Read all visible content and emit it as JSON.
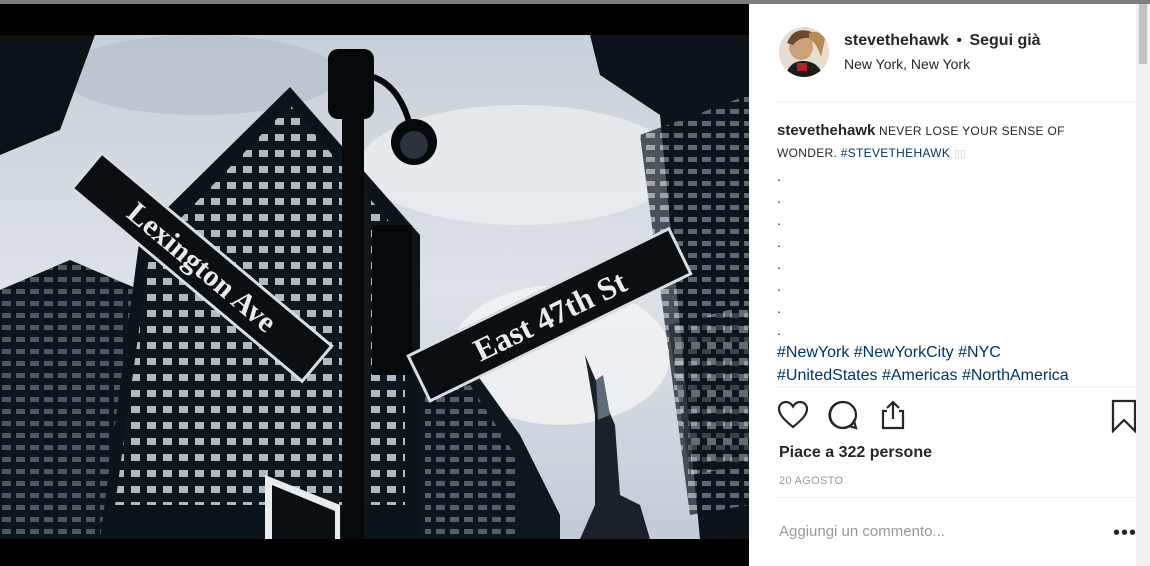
{
  "post": {
    "username": "stevethehawk",
    "separator": "•",
    "follow_status": "Segui già",
    "location": "New York, New York",
    "caption_user": "stevethehawk",
    "caption_text": "NEVER LOSE YOUR SENSE OF WONDER.",
    "caption_tag": "#STEVETHEHAWK",
    "dots": [
      ".",
      ".",
      ".",
      ".",
      ".",
      ".",
      ".",
      "."
    ],
    "hashtags_line1": "#NewYork #NewYorkCity #NYC",
    "hashtags_line2": "#UnitedStates #Americas #NorthAmerica",
    "likes": "Piace a 322 persone",
    "date": "20 AGOSTO",
    "comment_placeholder": "Aggiungi un commento...",
    "more_label": "•••"
  },
  "photo": {
    "sign1": "Lexington Ave",
    "sign2": "East 47th St"
  },
  "icons": {
    "like": "heart-icon",
    "comment": "comment-icon",
    "share": "share-icon",
    "save": "bookmark-icon",
    "more": "more-icon"
  },
  "colors": {
    "hashtag": "#003569",
    "text": "#262626",
    "muted": "#999999"
  }
}
